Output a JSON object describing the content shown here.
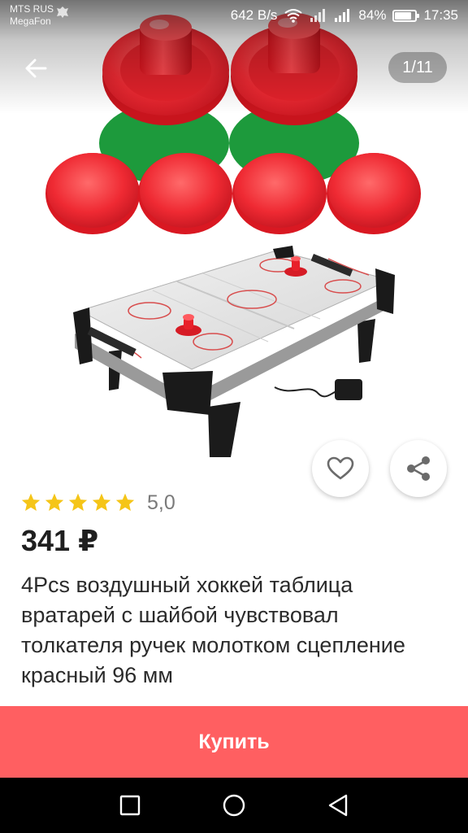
{
  "status_bar": {
    "carrier_line1": "MTS RUS",
    "carrier_line2": "MegaFon",
    "network_speed": "642 B/s",
    "battery_percent": "84%",
    "battery_level": 0.84,
    "time": "17:35"
  },
  "gallery": {
    "page_counter": "1/11"
  },
  "product": {
    "rating_stars": 5,
    "rating_value": "5,0",
    "price": "341 ₽",
    "title": "4Pcs воздушный хоккей таблица вратарей с шайбой чувствовал толкателя ручек молотком сцепление красный 96 мм"
  },
  "actions": {
    "buy_label": "Купить"
  },
  "colors": {
    "buy_button": "#ff5f61",
    "star": "#f5c518",
    "puck_red": "#e8202a",
    "felt_green": "#1d9a3c"
  },
  "icons": {
    "back": "arrow-left-icon",
    "favorite": "heart-icon",
    "share": "share-icon",
    "nav_recents": "square-icon",
    "nav_home": "circle-icon",
    "nav_back": "triangle-back-icon"
  }
}
